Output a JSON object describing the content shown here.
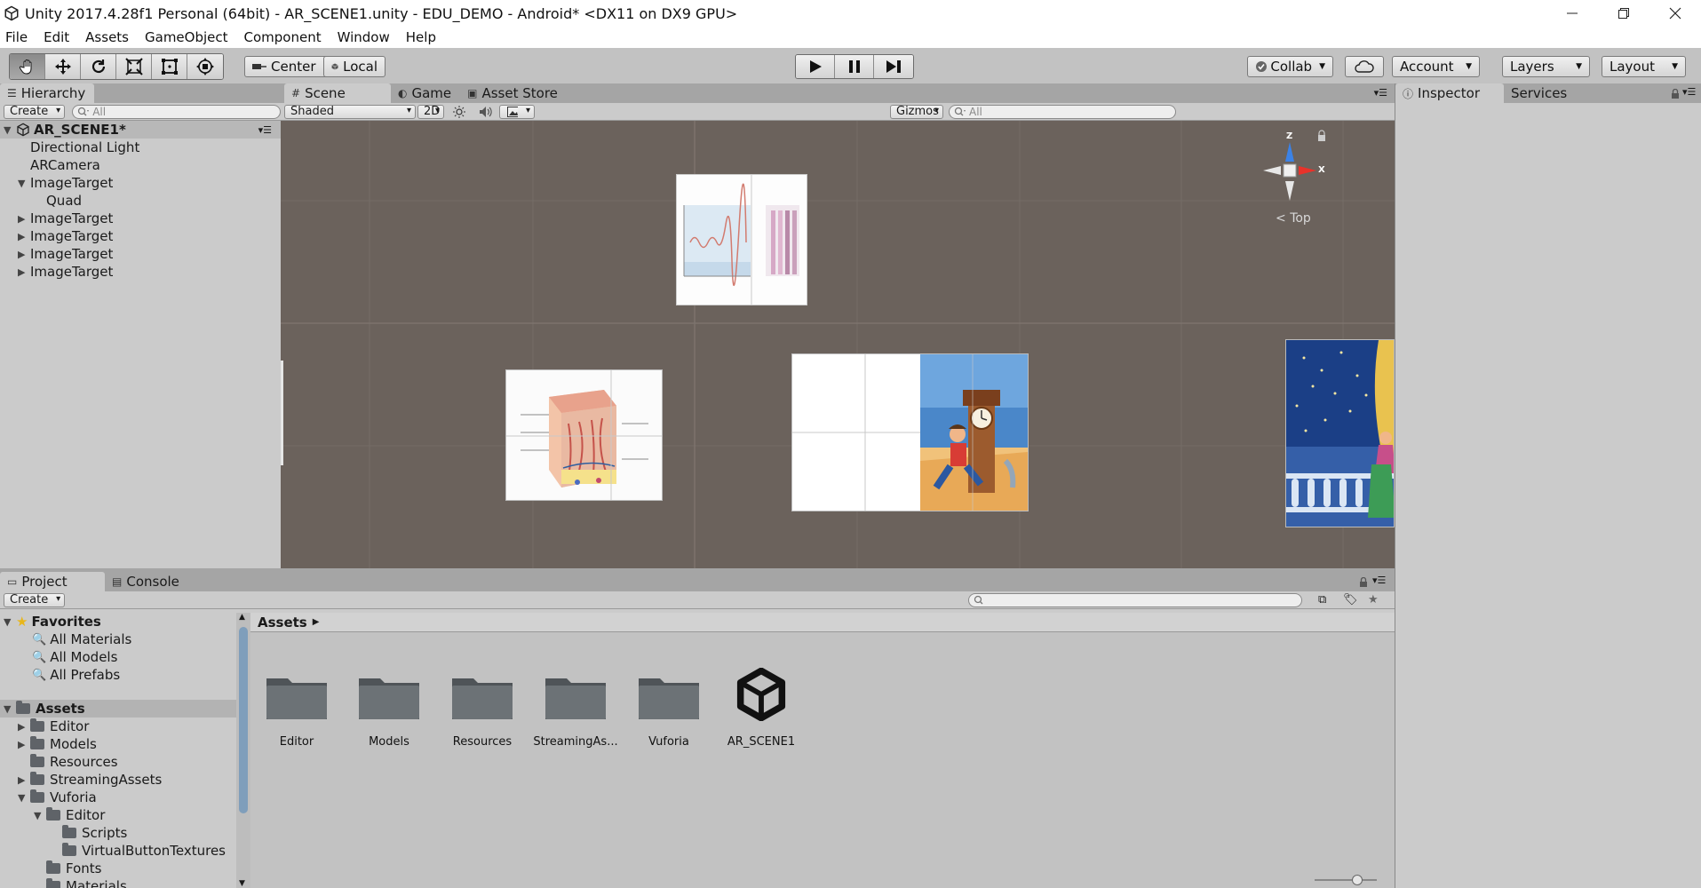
{
  "window": {
    "title": "Unity 2017.4.28f1 Personal (64bit) - AR_SCENE1.unity - EDU_DEMO - Android* <DX11 on DX9 GPU>"
  },
  "menu": [
    "File",
    "Edit",
    "Assets",
    "GameObject",
    "Component",
    "Window",
    "Help"
  ],
  "toolbar": {
    "center_label": "Center",
    "local_label": "Local",
    "collab_label": "Collab",
    "account_label": "Account",
    "layers_label": "Layers",
    "layout_label": "Layout"
  },
  "hierarchy": {
    "tab_label": "Hierarchy",
    "create_label": "Create",
    "search_placeholder": "All",
    "scene_name": "AR_SCENE1*",
    "items": [
      {
        "label": "Directional Light"
      },
      {
        "label": "ARCamera"
      },
      {
        "label": "ImageTarget"
      },
      {
        "label": "Quad"
      },
      {
        "label": "ImageTarget"
      },
      {
        "label": "ImageTarget"
      },
      {
        "label": "ImageTarget"
      },
      {
        "label": "ImageTarget"
      }
    ]
  },
  "scene": {
    "tabs": [
      {
        "label": "Scene"
      },
      {
        "label": "Game"
      },
      {
        "label": "Asset Store"
      }
    ],
    "shading_mode": "Shaded",
    "mode_2d_label": "2D",
    "gizmos_label": "Gizmos",
    "search_placeholder": "All",
    "gizmo_view_label": "Top",
    "gizmo_axes": {
      "z": "Z",
      "x": "X"
    }
  },
  "inspector": {
    "tabs": [
      {
        "label": "Inspector"
      },
      {
        "label": "Services"
      }
    ]
  },
  "project": {
    "tabs": [
      {
        "label": "Project"
      },
      {
        "label": "Console"
      }
    ],
    "create_label": "Create",
    "favorites_label": "Favorites",
    "favorites": [
      "All Materials",
      "All Models",
      "All Prefabs"
    ],
    "assets_root_label": "Assets",
    "tree": [
      {
        "label": "Editor"
      },
      {
        "label": "Models"
      },
      {
        "label": "Resources"
      },
      {
        "label": "StreamingAssets"
      },
      {
        "label": "Vuforia"
      },
      {
        "label": "Editor"
      },
      {
        "label": "Scripts"
      },
      {
        "label": "VirtualButtonTextures"
      },
      {
        "label": "Fonts"
      },
      {
        "label": "Materials"
      }
    ],
    "breadcrumb": "Assets",
    "assets": [
      {
        "label": "Editor"
      },
      {
        "label": "Models"
      },
      {
        "label": "Resources"
      },
      {
        "label": "StreamingAs..."
      },
      {
        "label": "Vuforia"
      },
      {
        "label": "AR_SCENE1"
      }
    ]
  },
  "colors": {
    "scene_bg": "#6b625c",
    "panel_bg": "#cbcbcb",
    "selection": "#b3b3b3",
    "gizmo_x": "#e8322a",
    "gizmo_y": "#9dce4b",
    "gizmo_z": "#3b82e6",
    "folder": "#5f6368"
  }
}
